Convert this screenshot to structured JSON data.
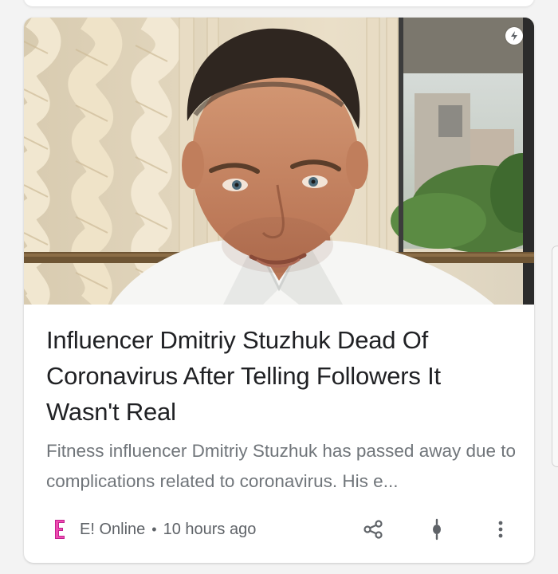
{
  "article": {
    "headline": "Influencer Dmitriy Stuzhuk Dead Of Coronavirus After Telling Followers It Wasn't Real",
    "snippet": "Fitness influencer Dmitriy Stuzhuk has passed away due to complications related to coronavirus. His e...",
    "image_alt": "Dmitriy Stuzhuk portrait photo",
    "source": {
      "logo_text": "E",
      "name": "E! Online",
      "separator": "•",
      "time_ago": "10 hours ago"
    }
  },
  "icons": {
    "amp": "lightning-bolt-icon",
    "share": "share-icon",
    "voice": "voice-search-icon",
    "more": "more-vert-icon"
  },
  "colors": {
    "headline": "#202124",
    "snippet": "#70757a",
    "meta": "#5f6368",
    "source_logo": "#c21f8f",
    "icon": "#5f6368"
  }
}
